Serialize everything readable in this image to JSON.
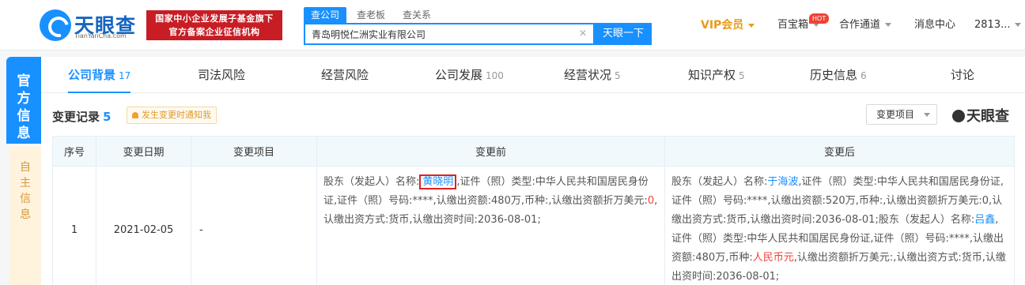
{
  "header": {
    "logo_text": "天眼查",
    "logo_sub": "TianYanCha.com",
    "slogan_line1": "国家中小企业发展子基金旗下",
    "slogan_line2": "官方备案企业征信机构",
    "search_tabs": [
      "查公司",
      "查老板",
      "查关系"
    ],
    "search_value": "青岛明悦仁洲实业有限公司",
    "search_button": "天眼一下",
    "vip": "VIP会员",
    "treasure": "百宝箱",
    "hot_badge": "HOT",
    "cooperation": "合作通道",
    "messages": "消息中心",
    "user": "2813..."
  },
  "side": {
    "official": "官方信息",
    "self": "自主信息"
  },
  "tabs": [
    {
      "label": "公司背景",
      "count": "17"
    },
    {
      "label": "司法风险",
      "count": ""
    },
    {
      "label": "经营风险",
      "count": ""
    },
    {
      "label": "公司发展",
      "count": "100"
    },
    {
      "label": "经营状况",
      "count": "5"
    },
    {
      "label": "知识产权",
      "count": "5"
    },
    {
      "label": "历史信息",
      "count": "6"
    },
    {
      "label": "讨论",
      "count": ""
    }
  ],
  "section": {
    "title": "变更记录",
    "count": "5",
    "notify": "发生变更时通知我",
    "filter": "变更项目",
    "watermark": "天眼查"
  },
  "table": {
    "headers": [
      "序号",
      "变更日期",
      "变更项目",
      "变更前",
      "变更后"
    ],
    "row": {
      "index": "1",
      "date": "2021-02-05",
      "item": "-",
      "before": {
        "p1": "股东（发起人）名称:",
        "name": "黄晓明",
        "p2": ",证件（照）类型:中华人民共和国居民身份证,证件（照）号码:****,认缴出资额:480万,币种:,认缴出资额折万美元:",
        "zero": "0",
        "p3": ",认缴出资方式:货币,认缴出资时间:2036-08-01;"
      },
      "after": {
        "p1": "股东（发起人）名称:",
        "name1": "于海波",
        "p2": ",证件（照）类型:中华人民共和国居民身份证,证件（照）号码:****,认缴出资额:520万,币种:,认缴出资额折万美元:0,认缴出资方式:货币,认缴出资时间:2036-08-01;股东（发起人）名称:",
        "name2": "吕鑫",
        "p3": ",证件（照）类型:中华人民共和国居民身份证,证件（照）号码:****,认缴出资额:480万,币种:",
        "currency": "人民币元",
        "p4": ",认缴出资额折万美元:,认缴出资方式:货币,认缴出资时间:2036-08-01;"
      }
    }
  }
}
